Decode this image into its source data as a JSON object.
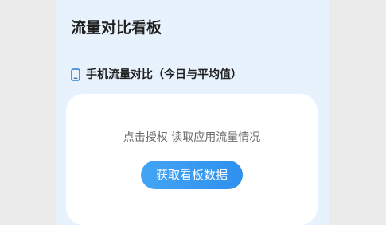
{
  "panel": {
    "title": "流量对比看板"
  },
  "section": {
    "icon": "phone-icon",
    "label": "手机流量对比（今日与平均值）"
  },
  "card": {
    "hint": "点击授权 读取应用流量情况",
    "button_label": "获取看板数据"
  },
  "colors": {
    "page_background": "#ebebeb",
    "panel_background": "#e7f2fd",
    "card_background": "#ffffff",
    "button_gradient_start": "#43a4f4",
    "button_gradient_end": "#2f90ef",
    "title_text": "#1f1f1f",
    "hint_text": "#6b6b6b",
    "icon_stroke": "#2a7fd4"
  }
}
